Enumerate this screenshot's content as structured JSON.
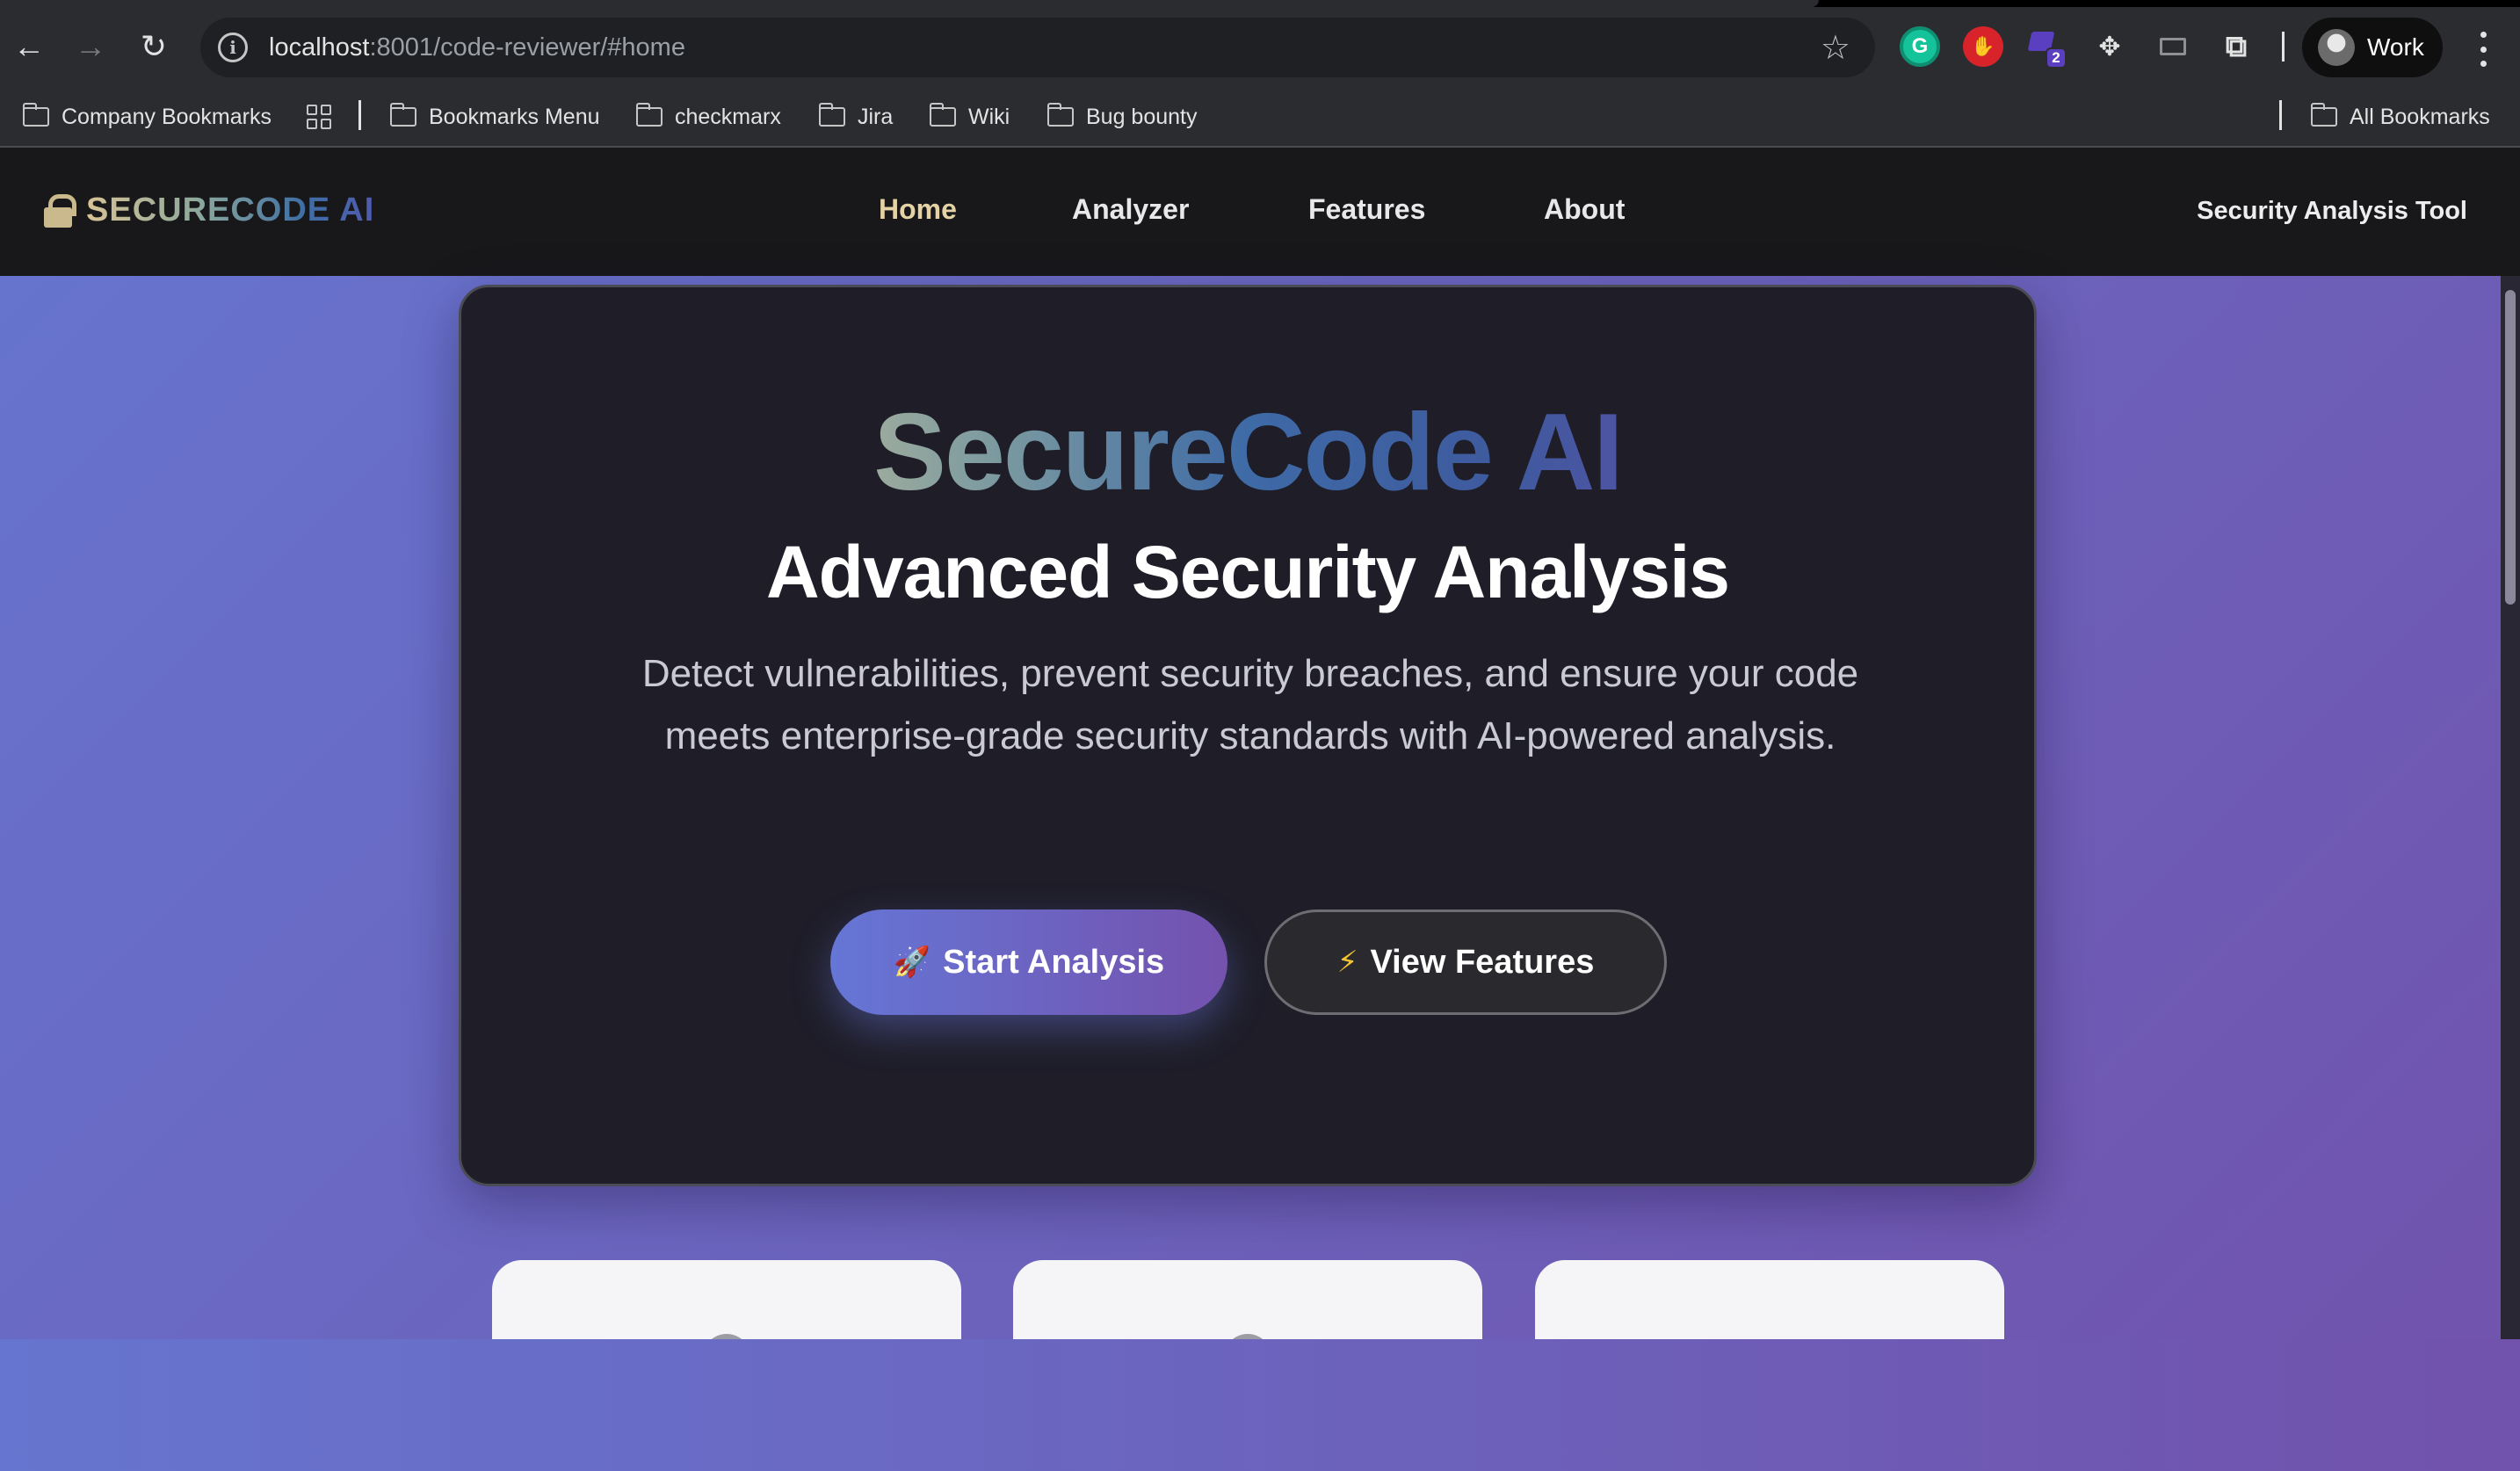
{
  "browser": {
    "url_host": "localhost",
    "url_rest": ":8001/code-reviewer/#home",
    "profile_label": "Work",
    "extension_badge": "2",
    "bookmarks": [
      "Company Bookmarks",
      "Bookmarks Menu",
      "checkmarx",
      "Jira",
      "Wiki",
      "Bug bounty"
    ],
    "all_bookmarks": "All Bookmarks",
    "icons": [
      "back-arrow-icon",
      "forward-arrow-icon",
      "reload-icon",
      "site-info-icon",
      "bookmark-star-icon",
      "grammarly-icon",
      "adblock-icon",
      "extension-icon",
      "extensions-puzzle-icon",
      "more-menu-icon",
      "apps-grid-icon",
      "folder-icon"
    ]
  },
  "site": {
    "brand": "SECURECODE AI",
    "nav": [
      "Home",
      "Analyzer",
      "Features",
      "About"
    ],
    "active_nav": "Home",
    "tagline": "Security Analysis Tool"
  },
  "hero": {
    "title": "SecureCode AI",
    "subtitle": "Advanced Security Analysis",
    "description": "Detect vulnerabilities, prevent security breaches, and ensure your code meets enterprise-grade security standards with AI-powered analysis.",
    "primary_button": {
      "emoji": "🚀",
      "label": "Start Analysis"
    },
    "secondary_button": {
      "emoji": "⚡",
      "label": "View Features"
    }
  },
  "colors": {
    "accent_start": "#6675cf",
    "accent_end": "#7152ac",
    "nav_active": "#e5d3a6",
    "hero_bg": "#1e1d28",
    "nav_bg": "#18181b"
  }
}
